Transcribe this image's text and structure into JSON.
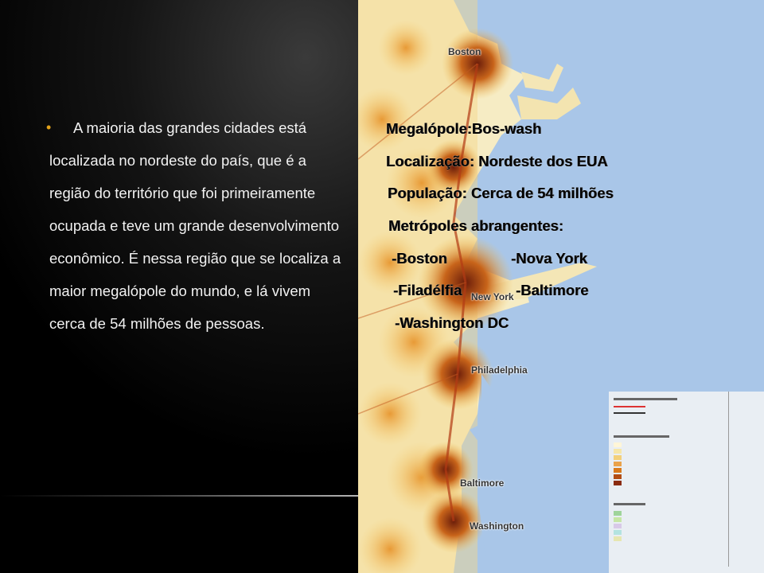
{
  "left_text": {
    "bullet": "•",
    "lines": [
      "A maioria das grandes cidades está",
      "localizada no nordeste do país, que é a",
      "região do território  que foi primeiramente",
      "ocupada e teve um grande desenvolvimento",
      "econômico. É nessa região que se localiza  a",
      "maior megalópole do mundo, e lá vivem",
      "cerca de 54 milhões de pessoas."
    ]
  },
  "overlay_text": {
    "megalopole": "Megalópole:Bos-wash",
    "localizacao": "Localização:  Nordeste dos EUA",
    "populacao": "População: Cerca de 54 milhões",
    "metropoles": "Metrópoles abrangentes:",
    "boston": "-Boston",
    "nova_york": "-Nova York",
    "filadelfia": "-Filadélfia",
    "baltimore": "-Baltimore",
    "washington": "-Washington  DC"
  },
  "map_labels": {
    "boston": "Boston",
    "new_york": "New York",
    "philadelphia": "Philadelphia",
    "baltimore": "Baltimore",
    "washington": "Washington"
  },
  "colors": {
    "ocean": "#a9c6e8",
    "land": "#f6ecc4",
    "urban": "#d97a1c",
    "dense": "#8a2b10",
    "bullet": "#e3a21a"
  }
}
